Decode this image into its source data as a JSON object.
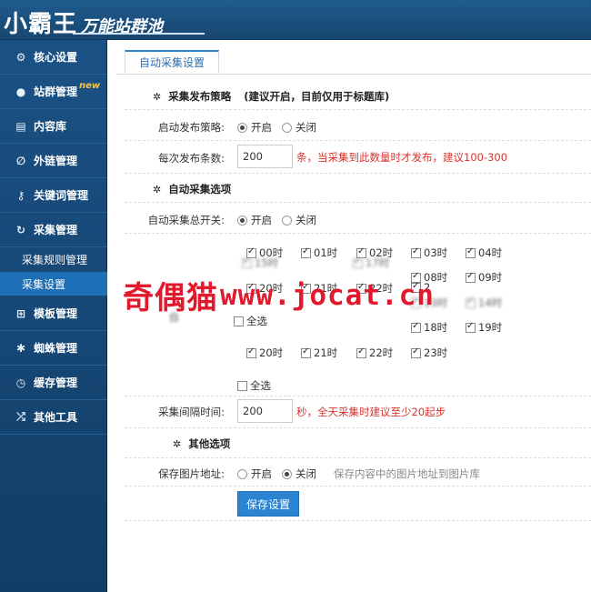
{
  "header": {
    "logo_main": "小霸王",
    "logo_sub": "万能站群池"
  },
  "sidebar": {
    "items": [
      {
        "label": "核心设置",
        "icon": "gear-icon"
      },
      {
        "label": "站群管理",
        "icon": "user-icon",
        "badge": "new"
      },
      {
        "label": "内容库",
        "icon": "document-icon"
      },
      {
        "label": "外链管理",
        "icon": "link-icon"
      },
      {
        "label": "关键词管理",
        "icon": "key-icon"
      },
      {
        "label": "采集管理",
        "icon": "refresh-icon"
      },
      {
        "label": "模板管理",
        "icon": "windows-icon"
      },
      {
        "label": "蜘蛛管理",
        "icon": "spider-icon"
      },
      {
        "label": "缓存管理",
        "icon": "clock-icon"
      },
      {
        "label": "其他工具",
        "icon": "shuffle-icon"
      }
    ],
    "subitems": [
      {
        "label": "采集规则管理",
        "active": false
      },
      {
        "label": "采集设置",
        "active": true
      }
    ]
  },
  "tab": {
    "label": "自动采集设置"
  },
  "publish": {
    "section_title": "采集发布策略",
    "section_note": "(建议开启，目前仅用于标题库)",
    "strategy_label": "启动发布策略:",
    "on_label": "开启",
    "off_label": "关闭",
    "count_label": "每次发布条数:",
    "count_value": "200",
    "count_hint": "条，当采集到此数量时才发布，建议100-300"
  },
  "auto": {
    "section_title": "自动采集选项",
    "switch_label": "自动采集总开关:",
    "on_label": "开启",
    "off_label": "关闭",
    "time_label_fragment": "自",
    "hours_row1": [
      "00时",
      "01时",
      "02时",
      "03时",
      "04时"
    ],
    "hours_row2_blur": [
      "15时",
      "17时"
    ],
    "hours_row3": [
      "08时",
      "09时"
    ],
    "hours_row4": [
      "20时",
      "21时",
      "22时",
      "2"
    ],
    "hours_row4_blur": [
      "13时",
      "14时"
    ],
    "hours_row5": [
      "18时",
      "19时"
    ],
    "hours_row6": [
      "20时",
      "21时",
      "22时",
      "23时"
    ],
    "select_all": "全选",
    "interval_label": "采集间隔时间:",
    "interval_value": "200",
    "interval_hint": "秒，全天采集时建议至少20起步"
  },
  "other": {
    "section_title": "其他选项",
    "save_image_label": "保存图片地址:",
    "on_label": "开启",
    "off_label": "关闭",
    "save_image_hint": "保存内容中的图片地址到图片库",
    "save_button": "保存设置"
  },
  "watermark": {
    "cn": "奇偶猫",
    "en": "www.jocat.cn"
  },
  "colors": {
    "accent": "#2a84d2",
    "warning": "#d9322c",
    "sidebar": "#1a5184",
    "watermark": "#e0192d"
  }
}
